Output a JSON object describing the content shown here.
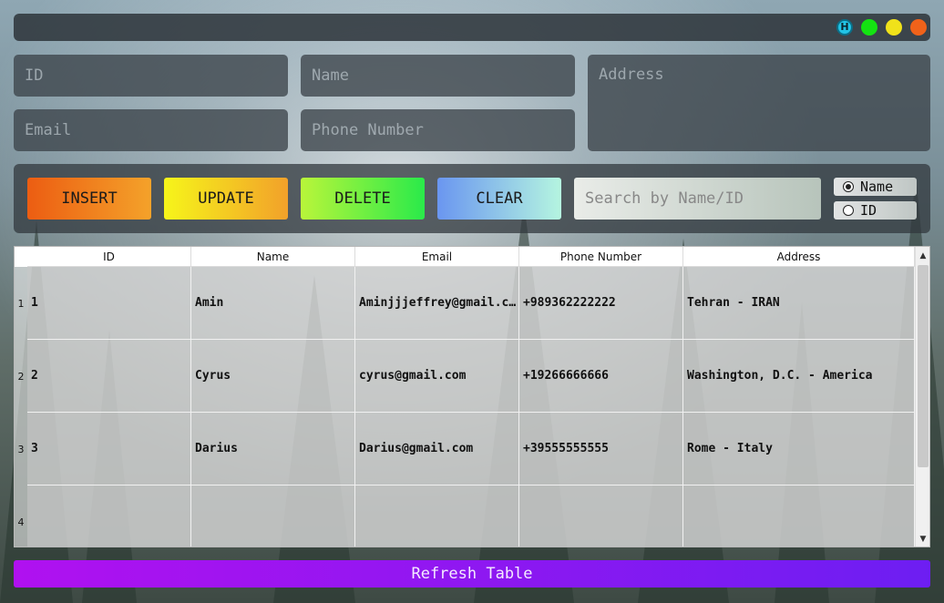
{
  "window": {
    "title_controls": [
      "H"
    ]
  },
  "form": {
    "id_placeholder": "ID",
    "name_placeholder": "Name",
    "address_placeholder": "Address",
    "email_placeholder": "Email",
    "phone_placeholder": "Phone Number"
  },
  "toolbar": {
    "insert_label": "INSERT",
    "update_label": "UPDATE",
    "delete_label": "DELETE",
    "clear_label": "CLEAR",
    "search_placeholder": "Search by Name/ID",
    "radio_name_label": "Name",
    "radio_id_label": "ID",
    "radio_selected": "Name"
  },
  "table": {
    "columns": [
      "ID",
      "Name",
      "Email",
      "Phone Number",
      "Address"
    ],
    "row_numbers": [
      "1",
      "2",
      "3",
      "4"
    ],
    "rows": [
      [
        "1",
        "Amin",
        "Aminjjjeffrey@gmail.com",
        "+989362222222",
        "Tehran - IRAN"
      ],
      [
        "2",
        "Cyrus",
        "cyrus@gmail.com",
        "+19266666666",
        "Washington, D.C. - America"
      ],
      [
        "3",
        "Darius",
        "Darius@gmail.com",
        "+39555555555",
        "Rome - Italy"
      ],
      [
        "",
        "",
        "",
        "",
        ""
      ]
    ]
  },
  "footer": {
    "refresh_label": "Refresh Table"
  },
  "colors": {
    "insert": "#ec5d12",
    "update": "#f6f51a",
    "delete": "#2aea4a",
    "clear": "#6a96f0",
    "refresh": "#9418f0"
  }
}
